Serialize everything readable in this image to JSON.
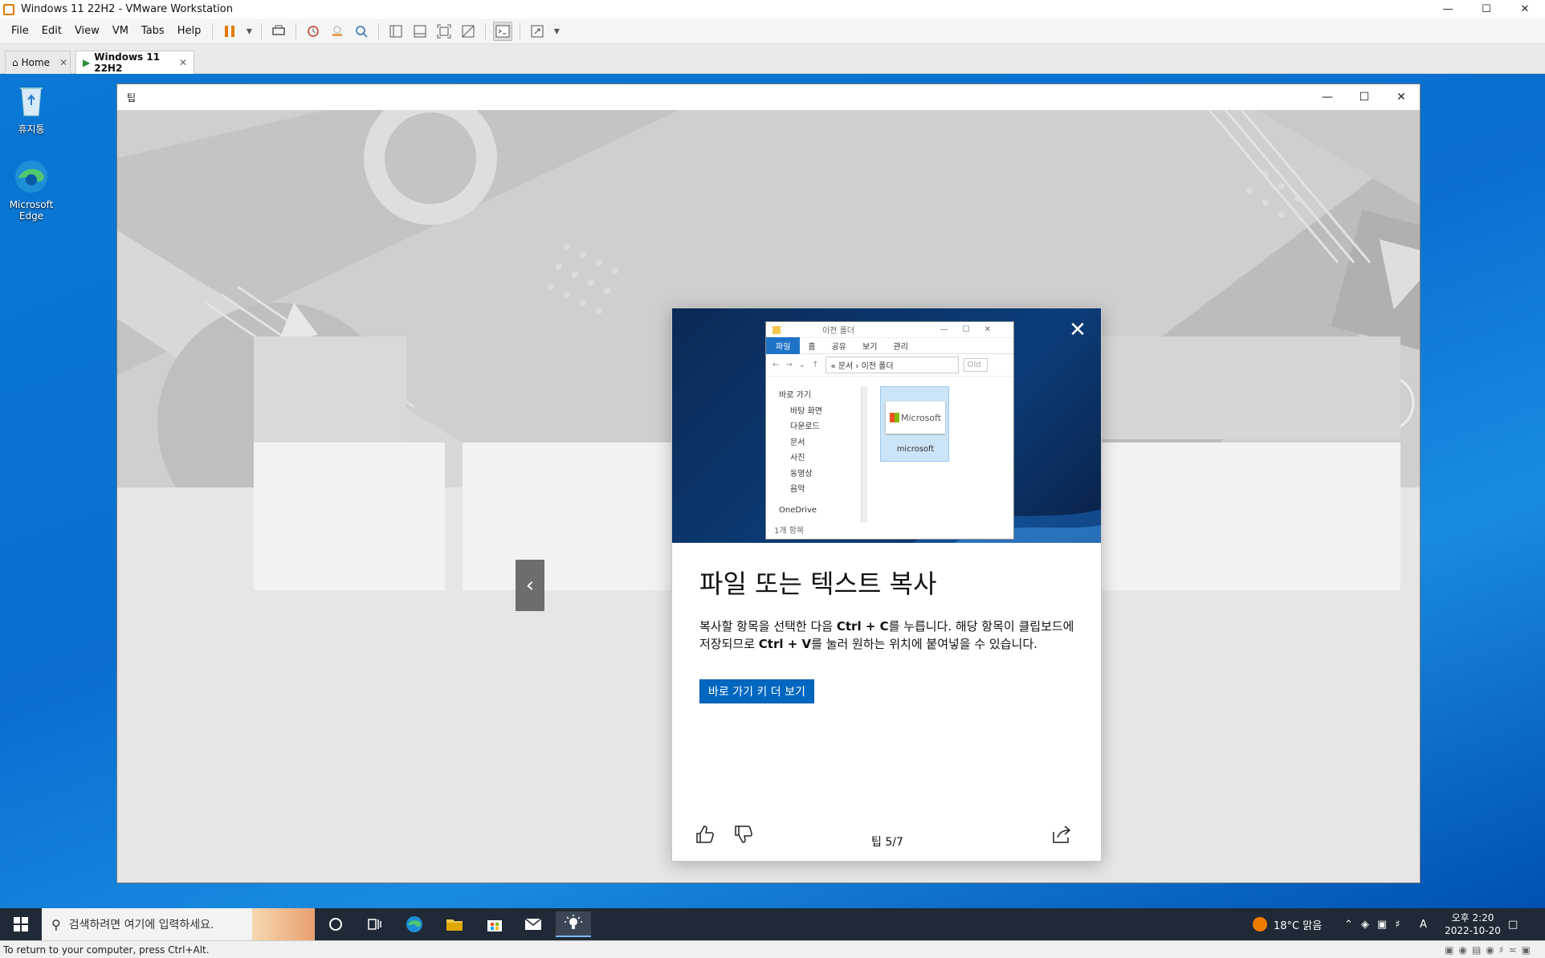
{
  "vmware": {
    "window_title": "Windows 11 22H2 - VMware Workstation",
    "menu": [
      "File",
      "Edit",
      "View",
      "VM",
      "Tabs",
      "Help"
    ],
    "tabs": [
      {
        "label": "Home",
        "icon": "home-icon"
      },
      {
        "label": "Windows 11 22H2",
        "icon": "vm-icon",
        "active": true
      }
    ],
    "status_text": "To return to your computer, press Ctrl+Alt.",
    "accent_color": "#e07b00"
  },
  "desktop": {
    "icons": [
      {
        "label": "휴지통",
        "icon": "recycle-bin-icon"
      },
      {
        "label": "Microsoft Edge",
        "icon": "edge-icon"
      }
    ]
  },
  "tips": {
    "window_title": "팁",
    "heading": "파일 또는 텍스트 복사",
    "body_parts": [
      {
        "t": "복사할 항목을 선택한 다음 ",
        "b": false
      },
      {
        "t": "Ctrl + C",
        "b": true
      },
      {
        "t": "를 누릅니다. 해당 항목이 클립보드에 저장되므로 ",
        "b": false
      },
      {
        "t": "Ctrl + V",
        "b": true
      },
      {
        "t": "를 눌러 원하는 위치에 붙여넣을 수 있습니다.",
        "b": false
      }
    ],
    "button_label": "바로 가기 키 더 보기",
    "counter": "팁 5/7",
    "button_color": "#0067c0",
    "explorer": {
      "title": "이전 폴더",
      "ribbon": [
        "파일",
        "홈",
        "공유",
        "보기",
        "관리"
      ],
      "path": "« 문서 › 이전 폴더",
      "search": "Old",
      "nav": [
        "바로 가기",
        "바탕 화면",
        "다운로드",
        "문서",
        "사진",
        "동영상",
        "음악",
        "OneDrive"
      ],
      "file_label": "microsoft",
      "file_logo_text": "Microsoft",
      "status": "1개 항목"
    }
  },
  "taskbar": {
    "search_placeholder": "검색하려면 여기에 입력하세요.",
    "weather": "18°C  맑음",
    "ime": "A",
    "time": "오후 2:20",
    "date": "2022-10-20",
    "color": "#1f2a36"
  }
}
